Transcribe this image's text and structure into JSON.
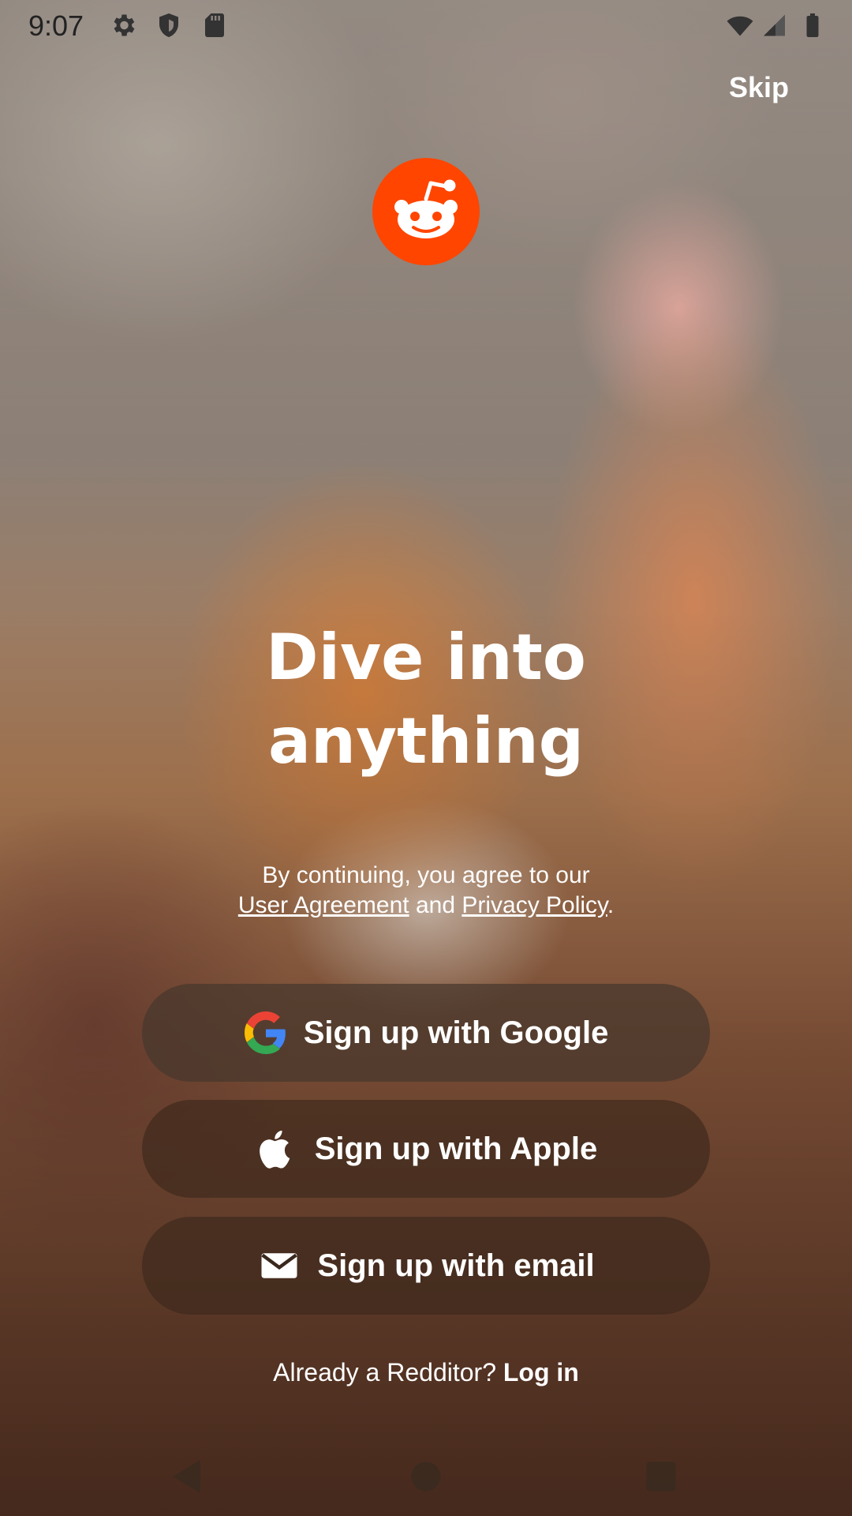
{
  "status_bar": {
    "time": "9:07",
    "icons": [
      "gear-icon",
      "shield-icon",
      "sd-card-icon",
      "wifi-icon",
      "signal-icon",
      "battery-icon"
    ]
  },
  "top": {
    "skip_label": "Skip"
  },
  "brand": {
    "logo_icon": "reddit-snoo-icon",
    "accent_color": "#ff4500"
  },
  "headline": {
    "line1": "Dive into",
    "line2": "anything"
  },
  "agreement": {
    "prefix": "By continuing, you agree to our",
    "user_agreement": "User Agreement",
    "and": " and ",
    "privacy_policy": "Privacy Policy",
    "suffix": "."
  },
  "buttons": {
    "google": {
      "label": "Sign up with Google",
      "icon": "google-icon"
    },
    "apple": {
      "label": "Sign up with Apple",
      "icon": "apple-icon"
    },
    "email": {
      "label": "Sign up with email",
      "icon": "mail-icon"
    }
  },
  "login": {
    "prompt": "Already a Redditor? ",
    "link": "Log in"
  },
  "nav_bar": {
    "icons": [
      "back-icon",
      "home-icon",
      "recents-icon"
    ]
  }
}
